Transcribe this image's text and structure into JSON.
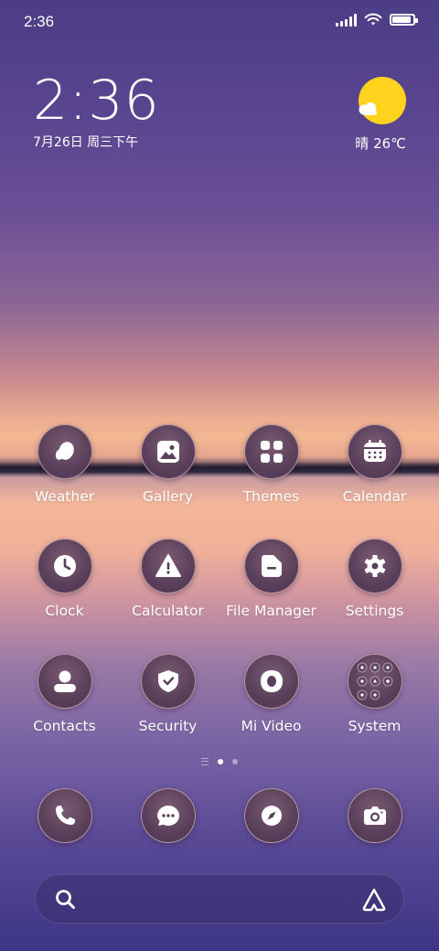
{
  "status_bar": {
    "time": "2:36",
    "battery_level": 0.9
  },
  "clock_widget": {
    "time": "2:36",
    "date": "7月26日 周三下午"
  },
  "weather_widget": {
    "text": "晴 26℃",
    "icon": "sunny-cloud-icon"
  },
  "apps": [
    {
      "label": "Weather",
      "icon": "weather-drop-icon"
    },
    {
      "label": "Gallery",
      "icon": "image-icon"
    },
    {
      "label": "Themes",
      "icon": "grid-icon"
    },
    {
      "label": "Calendar",
      "icon": "calendar-icon"
    },
    {
      "label": "Clock",
      "icon": "clock-icon"
    },
    {
      "label": "Calculator",
      "icon": "warning-triangle-icon"
    },
    {
      "label": "File Manager",
      "icon": "folder-icon"
    },
    {
      "label": "Settings",
      "icon": "gear-icon"
    },
    {
      "label": "Contacts",
      "icon": "person-icon"
    },
    {
      "label": "Security",
      "icon": "shield-check-icon"
    },
    {
      "label": "Mi Video",
      "icon": "video-icon"
    },
    {
      "label": "System",
      "icon": "folder-grid-icon"
    }
  ],
  "page_indicator": {
    "pages": 2,
    "current": 1
  },
  "dock": [
    {
      "icon": "phone-icon"
    },
    {
      "icon": "message-icon"
    },
    {
      "icon": "compass-icon"
    },
    {
      "icon": "camera-icon"
    }
  ],
  "search": {
    "icon": "search-icon",
    "assistant_icon": "assistant-icon"
  },
  "colors": {
    "sun": "#ffd21e",
    "icon_bg": "#5a3f5a"
  }
}
